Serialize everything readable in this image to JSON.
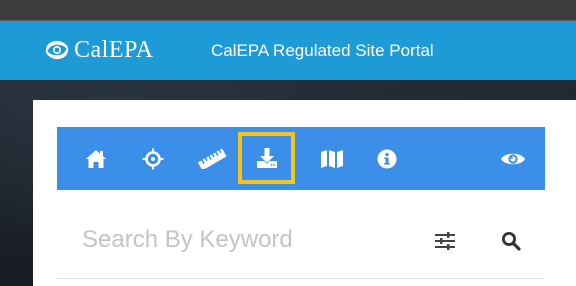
{
  "header": {
    "logo_text": "CalEPA",
    "portal_title": "CalEPA Regulated Site Portal",
    "background_color": "#1e9ad6"
  },
  "toolbar": {
    "background_color": "#3b8fe8",
    "selected_outline_color": "#f7c21a",
    "tools": [
      {
        "icon": "home-icon",
        "selected": false
      },
      {
        "icon": "crosshairs-icon",
        "selected": false
      },
      {
        "icon": "ruler-icon",
        "selected": false
      },
      {
        "icon": "download-icon",
        "selected": true
      },
      {
        "icon": "map-icon",
        "selected": false
      },
      {
        "icon": "info-icon",
        "selected": false
      },
      {
        "icon": "eye-icon",
        "selected": false
      }
    ]
  },
  "search": {
    "placeholder": "Search By Keyword",
    "value": "",
    "filter_icon": "sliders-icon",
    "search_icon": "search-icon"
  }
}
